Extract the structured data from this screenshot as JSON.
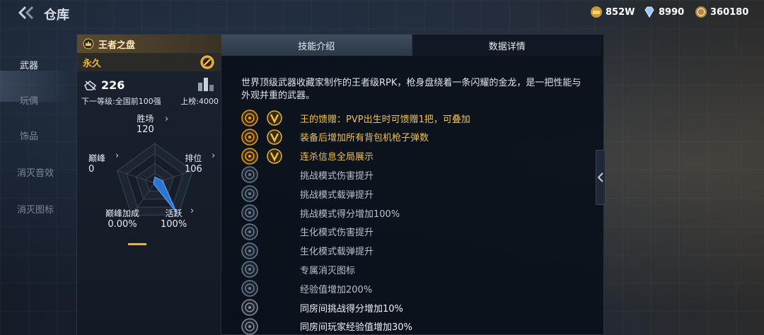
{
  "topbar": {
    "title": "仓库",
    "currencies": {
      "gold": "852W",
      "diamond": "8990",
      "coin": "360180"
    }
  },
  "nav": {
    "items": [
      "武器",
      "玩偶",
      "饰品",
      "消灭音效",
      "消灭图标"
    ]
  },
  "card": {
    "weapon_name": "王者之盘",
    "duration": "永久",
    "kill_count": "226",
    "next_level": "下一等级:全国前100强",
    "board": "上榜:4000",
    "stats": {
      "wins_label": "胜场",
      "wins_value": "120",
      "peak_label": "巅峰",
      "peak_value": "0",
      "rank_label": "排位",
      "rank_value": "106",
      "bonus_label": "巅峰加成",
      "bonus_value": "0.00%",
      "active_label": "活跃",
      "active_value": "100%"
    },
    "radar_levels": {
      "wins": 0.15,
      "rank": 0.2,
      "active": 0.95,
      "bonus": 0.0,
      "peak": 0.0
    }
  },
  "tabs": {
    "skills": "技能介绍",
    "details": "数据详情"
  },
  "description": "世界顶级武器收藏家制作的王者级RPK，枪身盘绕着一条闪耀的金龙，是一把性能与外观并重的武器。",
  "perks": [
    {
      "text": "王的馈赠：PVP出生时可馈赠1把，可叠加",
      "style": "gold",
      "icon": "gift-icon",
      "v": true
    },
    {
      "text": "装备后增加所有背包机枪子弹数",
      "style": "gold",
      "icon": "gun-ammo-icon",
      "v": true
    },
    {
      "text": "连杀信息全局展示",
      "style": "gold",
      "icon": "broadcast-icon",
      "v": true
    },
    {
      "text": "挑战模式伤害提升",
      "style": "grey",
      "icon": "challenge-damage-icon",
      "v": false
    },
    {
      "text": "挑战模式载弹提升",
      "style": "grey",
      "icon": "challenge-ammo-icon",
      "v": false
    },
    {
      "text": "挑战模式得分增加100%",
      "style": "grey",
      "icon": "challenge-score-icon",
      "v": false
    },
    {
      "text": "生化模式伤害提升",
      "style": "grey",
      "icon": "zombie-damage-icon",
      "v": false
    },
    {
      "text": "生化模式载弹提升",
      "style": "grey",
      "icon": "zombie-ammo-icon",
      "v": false
    },
    {
      "text": "专属消灭图标",
      "style": "grey",
      "icon": "kill-badge-icon",
      "v": false
    },
    {
      "text": "经验值增加200%",
      "style": "grey",
      "icon": "exp-icon",
      "v": false
    },
    {
      "text": "同房间挑战得分增加10%",
      "style": "white",
      "icon": "room-score-icon",
      "v": false
    },
    {
      "text": "同房间玩家经验值增加30%",
      "style": "white",
      "icon": "room-exp-icon",
      "v": false
    }
  ]
}
